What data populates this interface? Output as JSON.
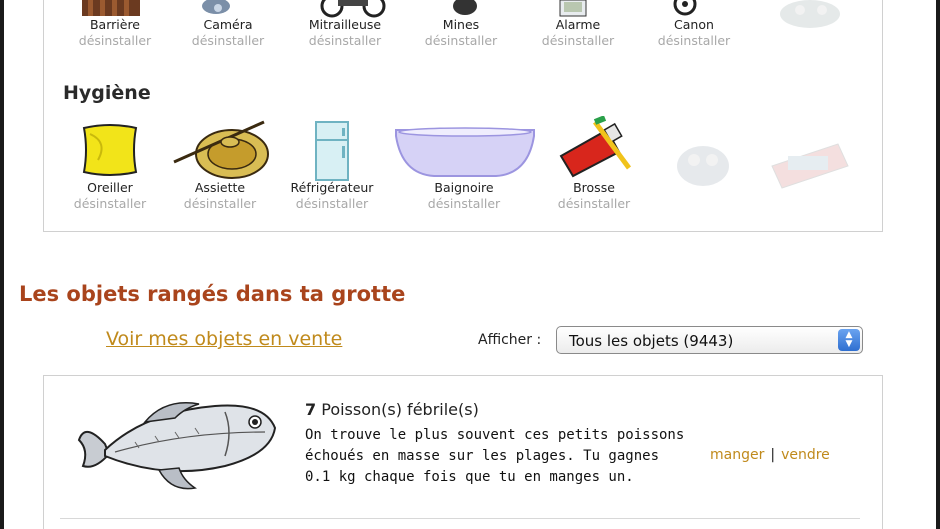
{
  "defense_items": [
    {
      "name": "Barrière",
      "action": "désinstaller",
      "icon": "fence-icon"
    },
    {
      "name": "Caméra",
      "action": "désinstaller",
      "icon": "camera-icon"
    },
    {
      "name": "Mitrailleuse",
      "action": "désinstaller",
      "icon": "machine-gun-icon"
    },
    {
      "name": "Mines",
      "action": "désinstaller",
      "icon": "mine-icon"
    },
    {
      "name": "Alarme",
      "action": "désinstaller",
      "icon": "alarm-icon"
    },
    {
      "name": "Canon",
      "action": "désinstaller",
      "icon": "cannon-icon"
    }
  ],
  "hygiene": {
    "title": "Hygiène",
    "items": [
      {
        "name": "Oreiller",
        "action": "désinstaller",
        "icon": "pillow-icon"
      },
      {
        "name": "Assiette",
        "action": "désinstaller",
        "icon": "plate-icon"
      },
      {
        "name": "Réfrigérateur",
        "action": "désinstaller",
        "icon": "fridge-icon"
      },
      {
        "name": "Baignoire",
        "action": "désinstaller",
        "icon": "bathtub-icon"
      },
      {
        "name": "Brosse",
        "action": "désinstaller",
        "icon": "toothbrush-icon"
      }
    ]
  },
  "stored": {
    "title": "Les objets rangés dans ta grotte",
    "sale_link": "Voir mes objets en vente",
    "filter_label": "Afficher :",
    "filter_value": "Tous les objets (9443)"
  },
  "fish": {
    "quantity": "7",
    "name": "Poisson(s) fébrile(s)",
    "description": "On trouve le plus souvent ces petits poissons échoués en masse sur les plages. Tu gagnes 0.1 kg chaque fois que tu en manges un.",
    "eat_label": "manger",
    "separator": "|",
    "sell_label": "vendre",
    "icon": "fish-icon"
  },
  "colors": {
    "section_title": "#a9441c",
    "link": "#c08a1c",
    "muted": "#a8a8a8"
  }
}
